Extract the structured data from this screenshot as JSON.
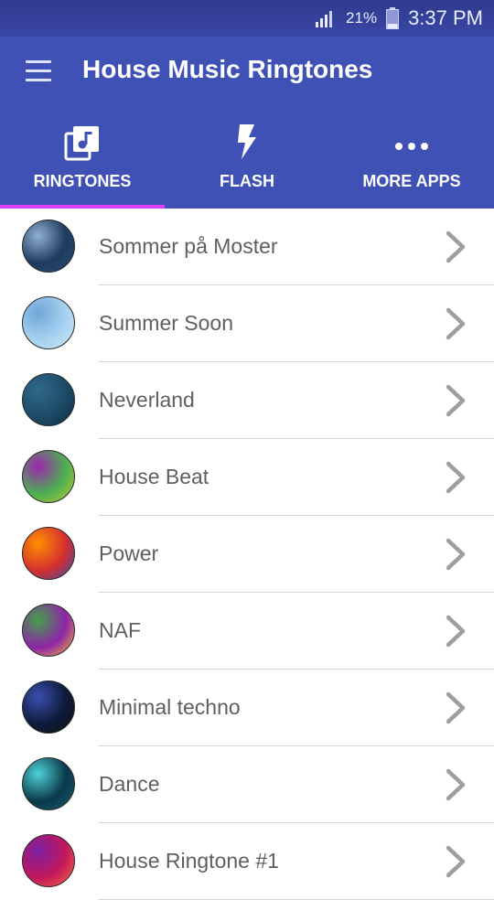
{
  "status_bar": {
    "battery_percent": "21%",
    "time": "3:37 PM"
  },
  "app_bar": {
    "title": "House Music Ringtones"
  },
  "tabs": [
    {
      "label": "RINGTONES",
      "icon": "music-library-icon",
      "selected": true
    },
    {
      "label": "FLASH",
      "icon": "flash-icon",
      "selected": false
    },
    {
      "label": "MORE APPS",
      "icon": "more-dots-icon",
      "selected": false
    }
  ],
  "ringtones": [
    {
      "title": "Sommer på Moster",
      "thumb_colors": [
        "#1e3a5f",
        "#8fb1d1",
        "#2d4d72"
      ]
    },
    {
      "title": "Summer Soon",
      "thumb_colors": [
        "#a7d2f0",
        "#6fa6d8",
        "#c9e6f8"
      ]
    },
    {
      "title": "Neverland",
      "thumb_colors": [
        "#1d4a66",
        "#2f6a8a",
        "#0f2f44"
      ]
    },
    {
      "title": "House Beat",
      "thumb_colors": [
        "#4caf50",
        "#9c27b0",
        "#c0ca33"
      ]
    },
    {
      "title": "Power",
      "thumb_colors": [
        "#d32f2f",
        "#ff8f00",
        "#3949ab"
      ]
    },
    {
      "title": "NAF",
      "thumb_colors": [
        "#8e24aa",
        "#43a047",
        "#fbc02d"
      ]
    },
    {
      "title": "Minimal techno",
      "thumb_colors": [
        "#0d1a3a",
        "#3a4fb0",
        "#111111"
      ]
    },
    {
      "title": "Dance",
      "thumb_colors": [
        "#0a3a4a",
        "#4fd1d9",
        "#1a5a6a"
      ]
    },
    {
      "title": "House Ringtone #1",
      "thumb_colors": [
        "#c2185b",
        "#7b1fa2",
        "#ff7043"
      ]
    }
  ],
  "colors": {
    "primary": "#3f51b5",
    "status_bar": "#2e3a8c",
    "tab_indicator": "#e040fb",
    "list_text": "#5f5f5f",
    "chevron": "#9e9e9e"
  }
}
